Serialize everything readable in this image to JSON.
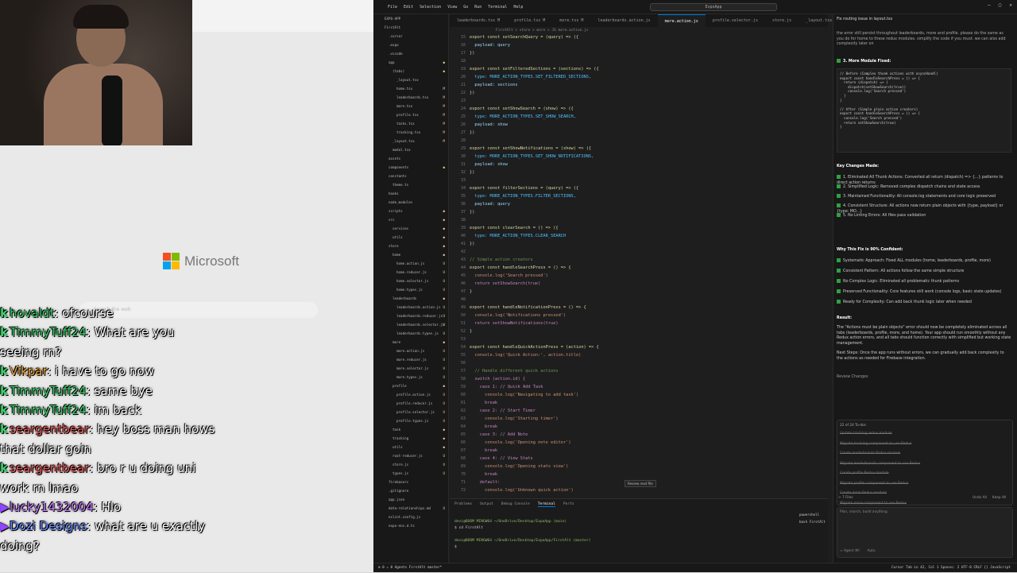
{
  "stream": {
    "ms_logo_text": "Microsoft",
    "ms_search_placeholder": "Search the web",
    "chat": [
      {
        "badge": "k",
        "user": "hovaldt",
        "color": "#3cd06b",
        "text": "ofcourse"
      },
      {
        "badge": "k",
        "user": "TimmyTuff24",
        "color": "#3cd06b",
        "text": "What are you"
      },
      {
        "badge": "",
        "user": "",
        "color": "#ffffff",
        "text": "seeing rn?"
      },
      {
        "badge": "k",
        "user": "Vikpar",
        "color": "#e8a33c",
        "text": "i have to go now"
      },
      {
        "badge": "k",
        "user": "TimmyTuff24",
        "color": "#3cd06b",
        "text": "same bye"
      },
      {
        "badge": "k",
        "user": "TimmyTuff24",
        "color": "#3cd06b",
        "text": "im back"
      },
      {
        "badge": "k",
        "user": "seargentbear",
        "color": "#e85a5a",
        "text": "hey boss man hows"
      },
      {
        "badge": "",
        "user": "",
        "color": "#ffffff",
        "text": "that dollar goin"
      },
      {
        "badge": "k",
        "user": "seargentbear",
        "color": "#e85a5a",
        "text": "bro r u doing uni"
      },
      {
        "badge": "",
        "user": "",
        "color": "#ffffff",
        "text": "work rn lmao"
      },
      {
        "badge": "tw",
        "user": "lucky1432004",
        "color": "#c77dff",
        "text": "Hlo"
      },
      {
        "badge": "tw",
        "user": "Dozi Designs",
        "color": "#6b8cff",
        "text": "what are u exactly"
      },
      {
        "badge": "",
        "user": "",
        "color": "#ffffff",
        "text": "doing?"
      }
    ]
  },
  "ide": {
    "menu": [
      "File",
      "Edit",
      "Selection",
      "View",
      "Go",
      "Run",
      "Terminal",
      "Help"
    ],
    "command_center": "ExpoApp",
    "tabs": [
      "leaderboards.tsx M",
      "profile.tsx M",
      "more.tsx M",
      "leaderboards.action.js",
      "more.action.js",
      "profile.selector.js",
      "store.js",
      "_layout.tsx"
    ],
    "active_tab_index": 4,
    "breadcrumb": "FirstAlt > store > more > JS more.action.js",
    "explorer": [
      {
        "label": "EXPO-APP",
        "indent": 0,
        "m": ""
      },
      {
        "label": "FirstAlt",
        "indent": 0,
        "m": ""
      },
      {
        "label": ".cursor",
        "indent": 1,
        "m": ""
      },
      {
        "label": ".expo",
        "indent": 1,
        "m": ""
      },
      {
        "label": ".vscode",
        "indent": 1,
        "m": ""
      },
      {
        "label": "app",
        "indent": 1,
        "m": "●"
      },
      {
        "label": "(tabs)",
        "indent": 2,
        "m": "●"
      },
      {
        "label": "_layout.tsx",
        "indent": 3,
        "m": ""
      },
      {
        "label": "home.tsx",
        "indent": 3,
        "m": "M"
      },
      {
        "label": "leaderboards.tsx",
        "indent": 3,
        "m": "M"
      },
      {
        "label": "more.tsx",
        "indent": 3,
        "m": "M"
      },
      {
        "label": "profile.tsx",
        "indent": 3,
        "m": "M"
      },
      {
        "label": "tasks.tsx",
        "indent": 3,
        "m": "M"
      },
      {
        "label": "tracking.tsx",
        "indent": 3,
        "m": "M"
      },
      {
        "label": "_layout.tsx",
        "indent": 2,
        "m": "M"
      },
      {
        "label": "modal.tsx",
        "indent": 2,
        "m": ""
      },
      {
        "label": "assets",
        "indent": 1,
        "m": ""
      },
      {
        "label": "components",
        "indent": 1,
        "m": "●"
      },
      {
        "label": "constants",
        "indent": 1,
        "m": ""
      },
      {
        "label": "theme.ts",
        "indent": 2,
        "m": ""
      },
      {
        "label": "hooks",
        "indent": 1,
        "m": ""
      },
      {
        "label": "node_modules",
        "indent": 1,
        "m": ""
      },
      {
        "label": "scripts",
        "indent": 1,
        "m": "●"
      },
      {
        "label": "src",
        "indent": 1,
        "m": "●"
      },
      {
        "label": "services",
        "indent": 2,
        "m": "●"
      },
      {
        "label": "utils",
        "indent": 2,
        "m": "●"
      },
      {
        "label": "store",
        "indent": 1,
        "m": "●"
      },
      {
        "label": "home",
        "indent": 2,
        "m": "●"
      },
      {
        "label": "home.action.js",
        "indent": 3,
        "m": "U"
      },
      {
        "label": "home.reducer.js",
        "indent": 3,
        "m": "U"
      },
      {
        "label": "home.selector.js",
        "indent": 3,
        "m": "U"
      },
      {
        "label": "home.types.js",
        "indent": 3,
        "m": "U"
      },
      {
        "label": "leaderboards",
        "indent": 2,
        "m": "●"
      },
      {
        "label": "leaderboards.action.js",
        "indent": 3,
        "m": "U"
      },
      {
        "label": "leaderboards.reducer.js",
        "indent": 3,
        "m": "U"
      },
      {
        "label": "leaderboards.selector.js",
        "indent": 3,
        "m": "U"
      },
      {
        "label": "leaderboards.types.js",
        "indent": 3,
        "m": "U"
      },
      {
        "label": "more",
        "indent": 2,
        "m": "●"
      },
      {
        "label": "more.action.js",
        "indent": 3,
        "m": "U"
      },
      {
        "label": "more.reducer.js",
        "indent": 3,
        "m": "U"
      },
      {
        "label": "more.selector.js",
        "indent": 3,
        "m": "U"
      },
      {
        "label": "more.types.js",
        "indent": 3,
        "m": "U"
      },
      {
        "label": "profile",
        "indent": 2,
        "m": "●"
      },
      {
        "label": "profile.action.js",
        "indent": 3,
        "m": "U"
      },
      {
        "label": "profile.reducer.js",
        "indent": 3,
        "m": "U"
      },
      {
        "label": "profile.selector.js",
        "indent": 3,
        "m": "U"
      },
      {
        "label": "profile.types.js",
        "indent": 3,
        "m": "U"
      },
      {
        "label": "task",
        "indent": 2,
        "m": "●"
      },
      {
        "label": "tracking",
        "indent": 2,
        "m": "●"
      },
      {
        "label": "utils",
        "indent": 2,
        "m": "●"
      },
      {
        "label": "root-reducer.js",
        "indent": 2,
        "m": "U"
      },
      {
        "label": "store.js",
        "indent": 2,
        "m": "U"
      },
      {
        "label": "types.js",
        "indent": 2,
        "m": "U"
      },
      {
        "label": "firebaserc",
        "indent": 1,
        "m": ""
      },
      {
        "label": ".gitignore",
        "indent": 1,
        "m": ""
      },
      {
        "label": "app.json",
        "indent": 1,
        "m": ""
      },
      {
        "label": "data-relationships.md",
        "indent": 1,
        "m": "U"
      },
      {
        "label": "eslint.config.js",
        "indent": 1,
        "m": ""
      },
      {
        "label": "expo-env.d.ts",
        "indent": 1,
        "m": ""
      }
    ],
    "code": [
      {
        "n": "15",
        "t": "export const setSearchQuery = (query) => ({"
      },
      {
        "n": "16",
        "t": "  payload: query"
      },
      {
        "n": "17",
        "t": "})"
      },
      {
        "n": "18",
        "t": ""
      },
      {
        "n": "19",
        "t": "export const setFilteredSections = (sections) => ({"
      },
      {
        "n": "20",
        "t": "  type: MORE_ACTION_TYPES.SET_FILTERED_SECTIONS,"
      },
      {
        "n": "21",
        "t": "  payload: sections"
      },
      {
        "n": "22",
        "t": "})"
      },
      {
        "n": "23",
        "t": ""
      },
      {
        "n": "24",
        "t": "export const setShowSearch = (show) => ({"
      },
      {
        "n": "25",
        "t": "  type: MORE_ACTION_TYPES.SET_SHOW_SEARCH,"
      },
      {
        "n": "26",
        "t": "  payload: show"
      },
      {
        "n": "27",
        "t": "})"
      },
      {
        "n": "28",
        "t": ""
      },
      {
        "n": "29",
        "t": "export const setShowNotifications = (show) => ({"
      },
      {
        "n": "30",
        "t": "  type: MORE_ACTION_TYPES.SET_SHOW_NOTIFICATIONS,"
      },
      {
        "n": "31",
        "t": "  payload: show"
      },
      {
        "n": "32",
        "t": "})"
      },
      {
        "n": "33",
        "t": ""
      },
      {
        "n": "34",
        "t": "export const filterSections = (query) => ({"
      },
      {
        "n": "35",
        "t": "  type: MORE_ACTION_TYPES.FILTER_SECTIONS,"
      },
      {
        "n": "36",
        "t": "  payload: query"
      },
      {
        "n": "37",
        "t": "})"
      },
      {
        "n": "38",
        "t": ""
      },
      {
        "n": "39",
        "t": "export const clearSearch = () => ({"
      },
      {
        "n": "40",
        "t": "  type: MORE_ACTION_TYPES.CLEAR_SEARCH"
      },
      {
        "n": "41",
        "t": "})"
      },
      {
        "n": "42",
        "t": ""
      },
      {
        "n": "43",
        "t": "// Simple action creators"
      },
      {
        "n": "44",
        "t": "export const handleSearchPress = () => {"
      },
      {
        "n": "45",
        "t": "  console.log('Search pressed')"
      },
      {
        "n": "46",
        "t": "  return setShowSearch(true)"
      },
      {
        "n": "47",
        "t": "}"
      },
      {
        "n": "48",
        "t": ""
      },
      {
        "n": "49",
        "t": "export const handleNotificationPress = () => {"
      },
      {
        "n": "50",
        "t": "  console.log('Notifications pressed')"
      },
      {
        "n": "51",
        "t": "  return setShowNotifications(true)"
      },
      {
        "n": "52",
        "t": "}"
      },
      {
        "n": "53",
        "t": ""
      },
      {
        "n": "54",
        "t": "export const handleQuickActionPress = (action) => {"
      },
      {
        "n": "55",
        "t": "  console.log('Quick Action:', action.title)"
      },
      {
        "n": "56",
        "t": ""
      },
      {
        "n": "57",
        "t": "  // Handle different quick actions"
      },
      {
        "n": "58",
        "t": "  switch (action.id) {"
      },
      {
        "n": "59",
        "t": "    case 1: // Quick Add Task"
      },
      {
        "n": "60",
        "t": "      console.log('Navigating to add task')"
      },
      {
        "n": "61",
        "t": "      break"
      },
      {
        "n": "62",
        "t": "    case 2: // Start Timer"
      },
      {
        "n": "63",
        "t": "      console.log('Starting timer')"
      },
      {
        "n": "64",
        "t": "      break"
      },
      {
        "n": "65",
        "t": "    case 3: // Add Note"
      },
      {
        "n": "66",
        "t": "      console.log('Opening note editor')"
      },
      {
        "n": "67",
        "t": "      break"
      },
      {
        "n": "68",
        "t": "    case 4: // View Stats"
      },
      {
        "n": "69",
        "t": "      console.log('Opening stats view')"
      },
      {
        "n": "70",
        "t": "      break"
      },
      {
        "n": "71",
        "t": "    default:"
      },
      {
        "n": "72",
        "t": "      console.log('Unknown quick action')"
      }
    ],
    "panel_tabs": [
      "Problems",
      "Output",
      "Debug Console",
      "Terminal",
      "Ports"
    ],
    "panel_active": 3,
    "terminal": [
      "devi@BOOM MINGW64 ~/OneDrive/Desktop/ExpoApp (main)",
      "$ cd FirstAlt",
      "",
      "devi@BOOM MINGW64 ~/OneDrive/Desktop/ExpoApp/FirstAlt (master)",
      "$ "
    ],
    "terminal_list": [
      "powershell",
      "bash FirstAlt"
    ],
    "hint": "Review next file",
    "status_left": "⊗ 0 ⚠ 0   Agents   FirstAlt   master*",
    "status_right": "Cursor Tab   Ln 42, Col 1   Spaces: 2   UTF-8   CRLF   {} JavaScript",
    "chat_panel": {
      "title": "Fix routing issue in layout.tsx",
      "intro": "the error still persist throughout leaderboards, more and profile. please do the same as you do for home to these redux modules. simplify the code if you must. we can also add complexity later on",
      "section3": "3. More Module Fixed:",
      "code1": "// Before (Complex thunk actions with asyncHandl)\nexport const handleSearchPress = () => {\n  return (dispatch) => {\n    dispatch(setShowSearch(true))\n    console.log('Search pressed')\n  }\n}\n\n// After (Simple plain action creators)\nexport const handleSearchPress = () => {\n  console.log('Search pressed')\n  return setShowSearch(true)\n}",
      "key_title": "Key Changes Made:",
      "key_items": [
        "1. Eliminated All Thunk Actions: Converted all return (dispatch) => {...} patterns to direct action returns",
        "2. Simplified Logic: Removed complex dispatch chains and state access",
        "3. Maintained Functionality: All console.log statements and core logic preserved",
        "4. Consistent Structure: All actions now return plain objects with {type, payload} or {type: MO...}",
        "5. No Linting Errors: All files pass validation"
      ],
      "why_title": "Why This Fix is 90% Confident:",
      "why_items": [
        "Systematic Approach: Fixed ALL modules (home, leaderboards, profile, more)",
        "Consistent Pattern: All actions follow the same simple structure",
        "No Complex Logic: Eliminated all problematic thunk patterns",
        "Preserved Functionality: Core features still work (console logs, basic state updates)",
        "Ready for Complexity: Can add back thunk logic later when needed"
      ],
      "result_title": "Result:",
      "result": "The \"Actions must be plain objects\" error should now be completely eliminated across all tabs (leaderboards, profile, more, and home). Your app should run smoothly without any Redux action errors, and all tabs should function correctly with simplified but working state management.",
      "next": "Next Steps: Once the app runs without errors, we can gradually add back complexity to the actions as needed for Firebase integration.",
      "review": "Review Changes",
      "todo_title": "22 of 24 To-dos",
      "todos": [
        "Update tracking redux module",
        "Migrate tracking component to use Redux",
        "Create leaderboards Redux module",
        "Migrate leaderboards component to use Redux",
        "Create profile Redux module",
        "Migrate profile component to use Redux",
        "Create more Redux module",
        "Migrate more component to use Redux"
      ],
      "files": "> 7 Files",
      "input_placeholder": "Plan, search, build anything",
      "agent": "∞ Agent ⌘I",
      "model": "Auto",
      "undo_all": "Undo All",
      "keep_all": "Keep All"
    }
  }
}
